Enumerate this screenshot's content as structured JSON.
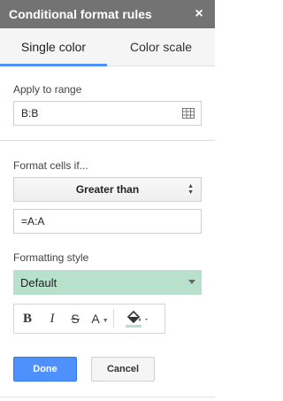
{
  "dialog": {
    "title": "Conditional format rules",
    "close_icon": "×"
  },
  "tabs": [
    {
      "label": "Single color",
      "active": true
    },
    {
      "label": "Color scale",
      "active": false
    }
  ],
  "apply_to_range": {
    "label": "Apply to range",
    "value": "B:B",
    "icon": "grid-range-icon"
  },
  "format_cells": {
    "label": "Format cells if...",
    "condition": "Greater than",
    "value": "=A:A"
  },
  "formatting_style": {
    "label": "Formatting style",
    "preset": "Default",
    "preset_color": "#b7e1cd",
    "toolbar": {
      "bold": "B",
      "italic": "I",
      "strikethrough": "S",
      "text_color": "A",
      "fill_color_icon": "paint-bucket-icon",
      "fill_color_underline": "#b7e1cd"
    }
  },
  "buttons": {
    "done": "Done",
    "cancel": "Cancel"
  },
  "colors": {
    "accent": "#4d90fe",
    "titlebar": "#737373"
  }
}
